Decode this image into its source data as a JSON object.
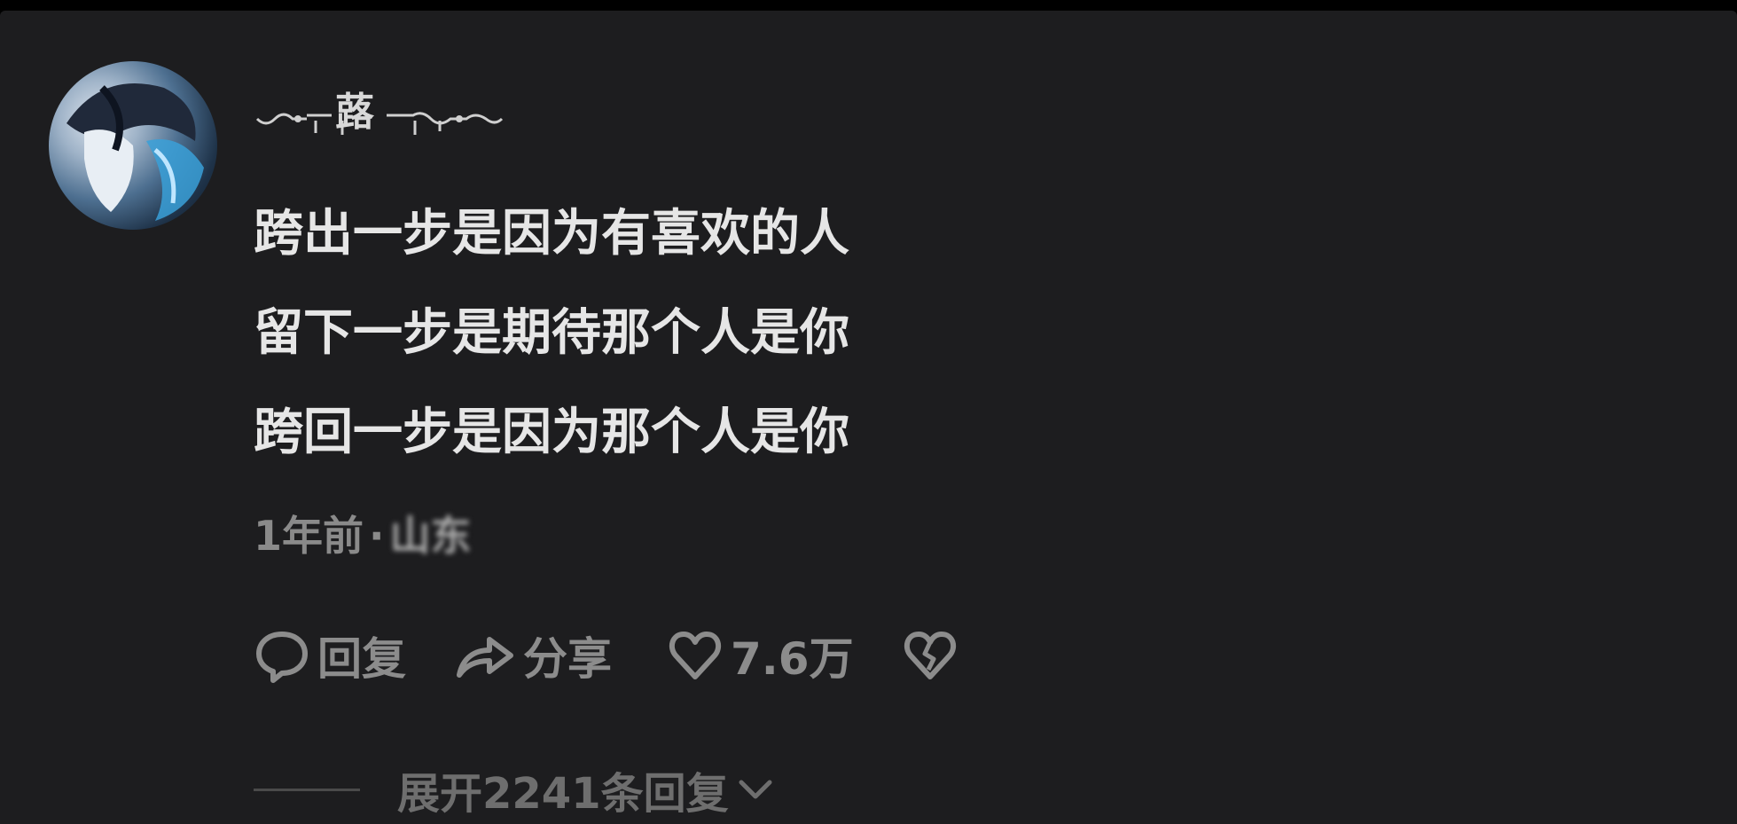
{
  "comment": {
    "username": "蕗",
    "lines": [
      "跨出一步是因为有喜欢的人",
      "留下一步是期待那个人是你",
      "跨回一步是因为那个人是你"
    ],
    "time": "1年前",
    "separator": "·",
    "location": "山东",
    "actions": {
      "reply_label": "回复",
      "share_label": "分享",
      "like_count": "7.6万"
    },
    "expand_label": "展开2241条回复"
  },
  "icons": {
    "reply": "speech-bubble-icon",
    "share": "share-arrow-icon",
    "like": "heart-icon",
    "dislike": "broken-heart-icon",
    "expand": "chevron-down-icon"
  },
  "colors": {
    "background": "#1d1d1f",
    "primary_text": "#e6e6e6",
    "secondary_text": "#8c8c8c"
  }
}
